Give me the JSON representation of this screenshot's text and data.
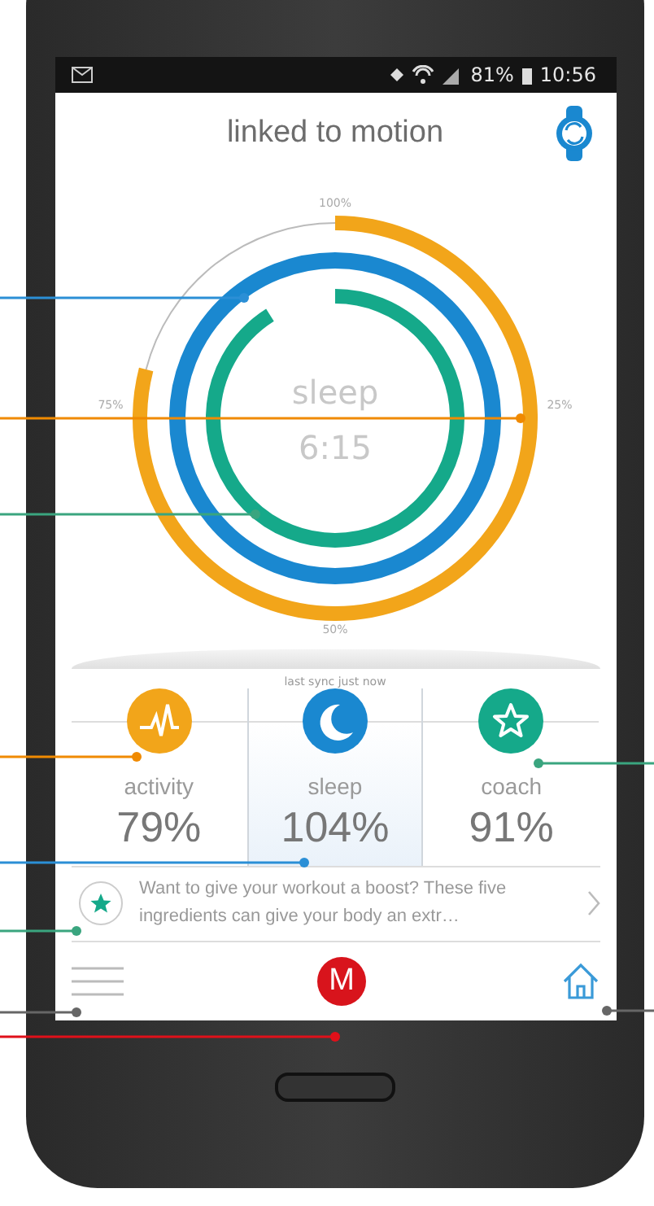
{
  "status_bar": {
    "battery": "81%",
    "time": "10:56"
  },
  "header": {
    "title": "linked to motion"
  },
  "dial": {
    "ticks": [
      {
        "text": "100%",
        "kind": "top"
      },
      {
        "text": "25%",
        "kind": "right"
      },
      {
        "text": "50%",
        "kind": "bottom"
      },
      {
        "text": "75%",
        "kind": "left"
      }
    ],
    "center_label": "sleep",
    "center_value": "6:15",
    "rings": [
      {
        "color": "#f2a51a",
        "level": 0.79
      },
      {
        "color": "#1a88d0",
        "level": 1.0
      },
      {
        "color": "#15a98a",
        "level": 0.91
      }
    ]
  },
  "sync": "last sync just now",
  "tiles": [
    {
      "kind": "activity",
      "label": "activity",
      "value": "79%",
      "color": "#f2a51a",
      "selected": false
    },
    {
      "kind": "sleep",
      "label": "sleep",
      "value": "104%",
      "color": "#1a88d0",
      "selected": true
    },
    {
      "kind": "coach",
      "label": "coach",
      "value": "91%",
      "color": "#15a98a",
      "selected": false
    }
  ],
  "tip": {
    "text": "Want to give your workout a boost? These five ingredients can give your body an extr…"
  },
  "nav": {
    "logo": "M"
  }
}
